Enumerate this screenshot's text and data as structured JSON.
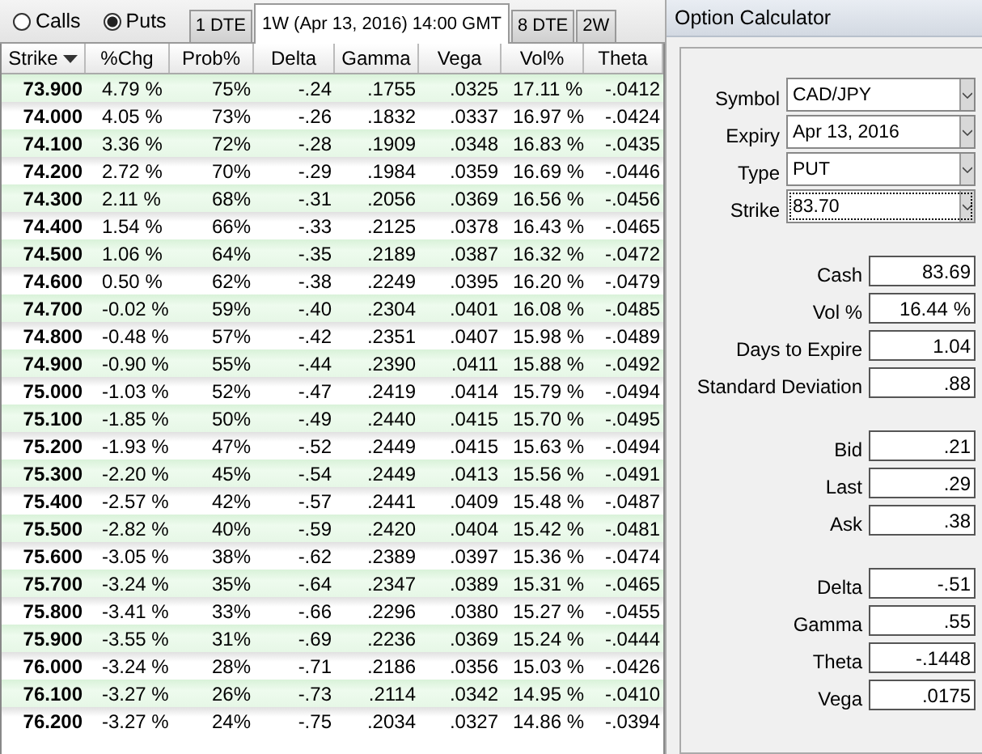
{
  "mode_options": [
    {
      "label": "Calls",
      "selected": false
    },
    {
      "label": "Puts",
      "selected": true
    }
  ],
  "expiry_tabs": [
    {
      "label": "1 DTE",
      "selected": false
    },
    {
      "label": "1W (Apr 13, 2016) 14:00 GMT",
      "selected": true
    },
    {
      "label": "8 DTE",
      "selected": false
    },
    {
      "label": "2W",
      "selected": false
    }
  ],
  "table": {
    "columns": [
      {
        "label": "Strike",
        "sorted": true
      },
      {
        "label": "%Chg",
        "sorted": false
      },
      {
        "label": "Prob%",
        "sorted": false
      },
      {
        "label": "Delta",
        "sorted": false
      },
      {
        "label": "Gamma",
        "sorted": false
      },
      {
        "label": "Vega",
        "sorted": false
      },
      {
        "label": "Vol%",
        "sorted": false
      },
      {
        "label": "Theta",
        "sorted": false
      }
    ],
    "rows": [
      [
        "73.900",
        "4.79 %",
        "75%",
        "-.24",
        ".1755",
        ".0325",
        "17.11 %",
        "-.0412"
      ],
      [
        "74.000",
        "4.05 %",
        "73%",
        "-.26",
        ".1832",
        ".0337",
        "16.97 %",
        "-.0424"
      ],
      [
        "74.100",
        "3.36 %",
        "72%",
        "-.28",
        ".1909",
        ".0348",
        "16.83 %",
        "-.0435"
      ],
      [
        "74.200",
        "2.72 %",
        "70%",
        "-.29",
        ".1984",
        ".0359",
        "16.69 %",
        "-.0446"
      ],
      [
        "74.300",
        "2.11 %",
        "68%",
        "-.31",
        ".2056",
        ".0369",
        "16.56 %",
        "-.0456"
      ],
      [
        "74.400",
        "1.54 %",
        "66%",
        "-.33",
        ".2125",
        ".0378",
        "16.43 %",
        "-.0465"
      ],
      [
        "74.500",
        "1.06 %",
        "64%",
        "-.35",
        ".2189",
        ".0387",
        "16.32 %",
        "-.0472"
      ],
      [
        "74.600",
        "0.50 %",
        "62%",
        "-.38",
        ".2249",
        ".0395",
        "16.20 %",
        "-.0479"
      ],
      [
        "74.700",
        "-0.02 %",
        "59%",
        "-.40",
        ".2304",
        ".0401",
        "16.08 %",
        "-.0485"
      ],
      [
        "74.800",
        "-0.48 %",
        "57%",
        "-.42",
        ".2351",
        ".0407",
        "15.98 %",
        "-.0489"
      ],
      [
        "74.900",
        "-0.90 %",
        "55%",
        "-.44",
        ".2390",
        ".0411",
        "15.88 %",
        "-.0492"
      ],
      [
        "75.000",
        "-1.03 %",
        "52%",
        "-.47",
        ".2419",
        ".0414",
        "15.79 %",
        "-.0494"
      ],
      [
        "75.100",
        "-1.85 %",
        "50%",
        "-.49",
        ".2440",
        ".0415",
        "15.70 %",
        "-.0495"
      ],
      [
        "75.200",
        "-1.93 %",
        "47%",
        "-.52",
        ".2449",
        ".0415",
        "15.63 %",
        "-.0494"
      ],
      [
        "75.300",
        "-2.20 %",
        "45%",
        "-.54",
        ".2449",
        ".0413",
        "15.56 %",
        "-.0491"
      ],
      [
        "75.400",
        "-2.57 %",
        "42%",
        "-.57",
        ".2441",
        ".0409",
        "15.48 %",
        "-.0487"
      ],
      [
        "75.500",
        "-2.82 %",
        "40%",
        "-.59",
        ".2420",
        ".0404",
        "15.42 %",
        "-.0481"
      ],
      [
        "75.600",
        "-3.05 %",
        "38%",
        "-.62",
        ".2389",
        ".0397",
        "15.36 %",
        "-.0474"
      ],
      [
        "75.700",
        "-3.24 %",
        "35%",
        "-.64",
        ".2347",
        ".0389",
        "15.31 %",
        "-.0465"
      ],
      [
        "75.800",
        "-3.41 %",
        "33%",
        "-.66",
        ".2296",
        ".0380",
        "15.27 %",
        "-.0455"
      ],
      [
        "75.900",
        "-3.55 %",
        "31%",
        "-.69",
        ".2236",
        ".0369",
        "15.24 %",
        "-.0444"
      ],
      [
        "76.000",
        "-3.24 %",
        "28%",
        "-.71",
        ".2186",
        ".0356",
        "15.03 %",
        "-.0426"
      ],
      [
        "76.100",
        "-3.27 %",
        "26%",
        "-.73",
        ".2114",
        ".0342",
        "14.95 %",
        "-.0410"
      ],
      [
        "76.200",
        "-3.27 %",
        "24%",
        "-.75",
        ".2034",
        ".0327",
        "14.86 %",
        "-.0394"
      ]
    ]
  },
  "calculator": {
    "title": "Option Calculator",
    "selectors": [
      {
        "label": "Symbol",
        "value": "CAD/JPY",
        "focused": false
      },
      {
        "label": "Expiry",
        "value": "Apr 13, 2016",
        "focused": false
      },
      {
        "label": "Type",
        "value": "PUT",
        "focused": false
      },
      {
        "label": "Strike",
        "value": "83.70",
        "focused": true
      }
    ],
    "field_groups": [
      [
        {
          "label": "Cash",
          "value": "83.69"
        },
        {
          "label": "Vol %",
          "value": "16.44 %"
        },
        {
          "label": "Days to Expire",
          "value": "1.04"
        },
        {
          "label": "Standard Deviation",
          "value": ".88"
        }
      ],
      [
        {
          "label": "Bid",
          "value": ".21"
        },
        {
          "label": "Last",
          "value": ".29"
        },
        {
          "label": "Ask",
          "value": ".38"
        }
      ],
      [
        {
          "label": "Delta",
          "value": "-.51"
        },
        {
          "label": "Gamma",
          "value": ".55"
        },
        {
          "label": "Theta",
          "value": "-.1448"
        },
        {
          "label": "Vega",
          "value": ".0175"
        }
      ]
    ]
  }
}
